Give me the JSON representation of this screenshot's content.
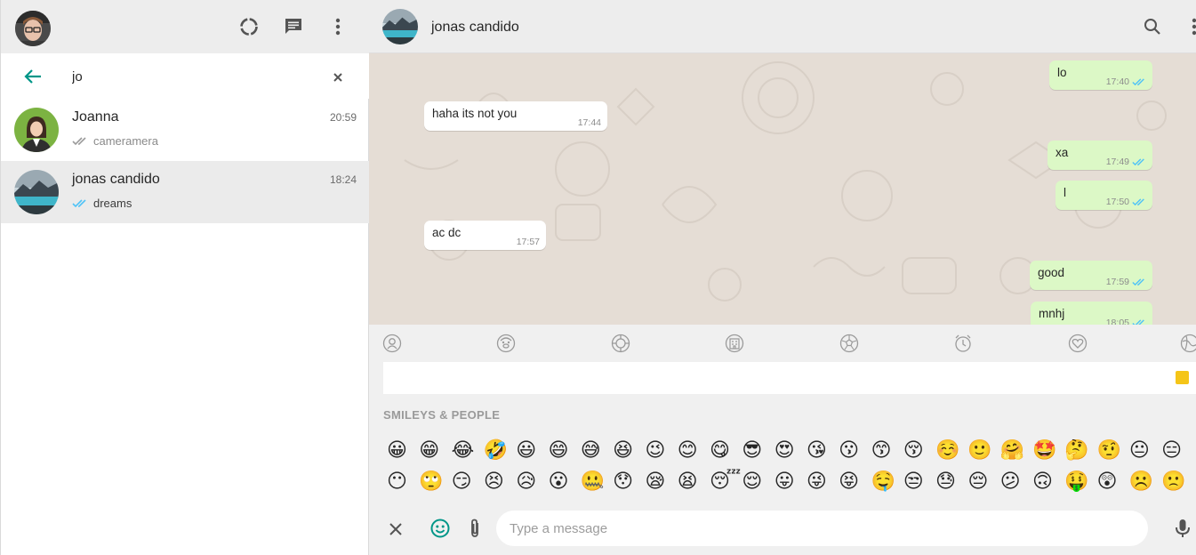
{
  "colors": {
    "accent": "#009688",
    "outgoing_bubble": "#dcf8c6",
    "incoming_bubble": "#ffffff",
    "chat_background": "#e5ddd5",
    "read_tick": "#4fc3f7"
  },
  "sidebar": {
    "header_icons": [
      "status-icon",
      "new-chat-icon",
      "menu-icon"
    ],
    "search": {
      "value": "jo",
      "back_icon": "arrow-left-icon",
      "clear_icon": "close-icon"
    },
    "chats": [
      {
        "name": "Joanna",
        "time": "20:59",
        "preview": "cameramera",
        "ticks": "gray-double-tick",
        "active": false
      },
      {
        "name": "jonas candido",
        "time": "18:24",
        "preview": "dreams",
        "ticks": "blue-double-tick",
        "active": true
      }
    ]
  },
  "conversation": {
    "contact_name": "jonas candido",
    "header_icons": [
      "search-icon",
      "menu-icon"
    ],
    "messages": [
      {
        "direction": "out",
        "text": "lo",
        "time": "17:40"
      },
      {
        "direction": "in",
        "text": "haha its not you",
        "time": "17:44"
      },
      {
        "direction": "out",
        "text": "xa",
        "time": "17:49"
      },
      {
        "direction": "out",
        "text": "l",
        "time": "17:50"
      },
      {
        "direction": "in",
        "text": "ac dc",
        "time": "17:57"
      },
      {
        "direction": "out",
        "text": "good",
        "time": "17:59"
      },
      {
        "direction": "out",
        "text": "mnhj",
        "time": "18:05"
      }
    ]
  },
  "emoji_panel": {
    "categories": [
      "people-icon",
      "animals-icon",
      "food-icon",
      "travel-icon",
      "sports-icon",
      "objects-icon",
      "symbols-icon",
      "flags-icon"
    ],
    "section_title": "SMILEYS & PEOPLE",
    "rows": [
      [
        "😀",
        "😁",
        "😂",
        "🤣",
        "😃",
        "😄",
        "😅",
        "😆",
        "😉",
        "😊",
        "😋",
        "😎",
        "😍",
        "😘",
        "😗",
        "😙",
        "😚",
        "☺️",
        "🙂",
        "🤗",
        "🤩",
        "🤔",
        "🤨",
        "😐",
        "😑"
      ],
      [
        "😶",
        "🙄",
        "😏",
        "😣",
        "😥",
        "😮",
        "🤐",
        "😯",
        "😪",
        "😫",
        "😴",
        "😌",
        "😛",
        "😜",
        "😝",
        "🤤",
        "😒",
        "😓",
        "😔",
        "😕",
        "🙃",
        "🤑",
        "😲",
        "☹️",
        "🙁"
      ]
    ]
  },
  "composer": {
    "placeholder": "Type a message",
    "icons": [
      "close-icon",
      "emoji-icon",
      "attach-icon",
      "mic-icon"
    ]
  }
}
